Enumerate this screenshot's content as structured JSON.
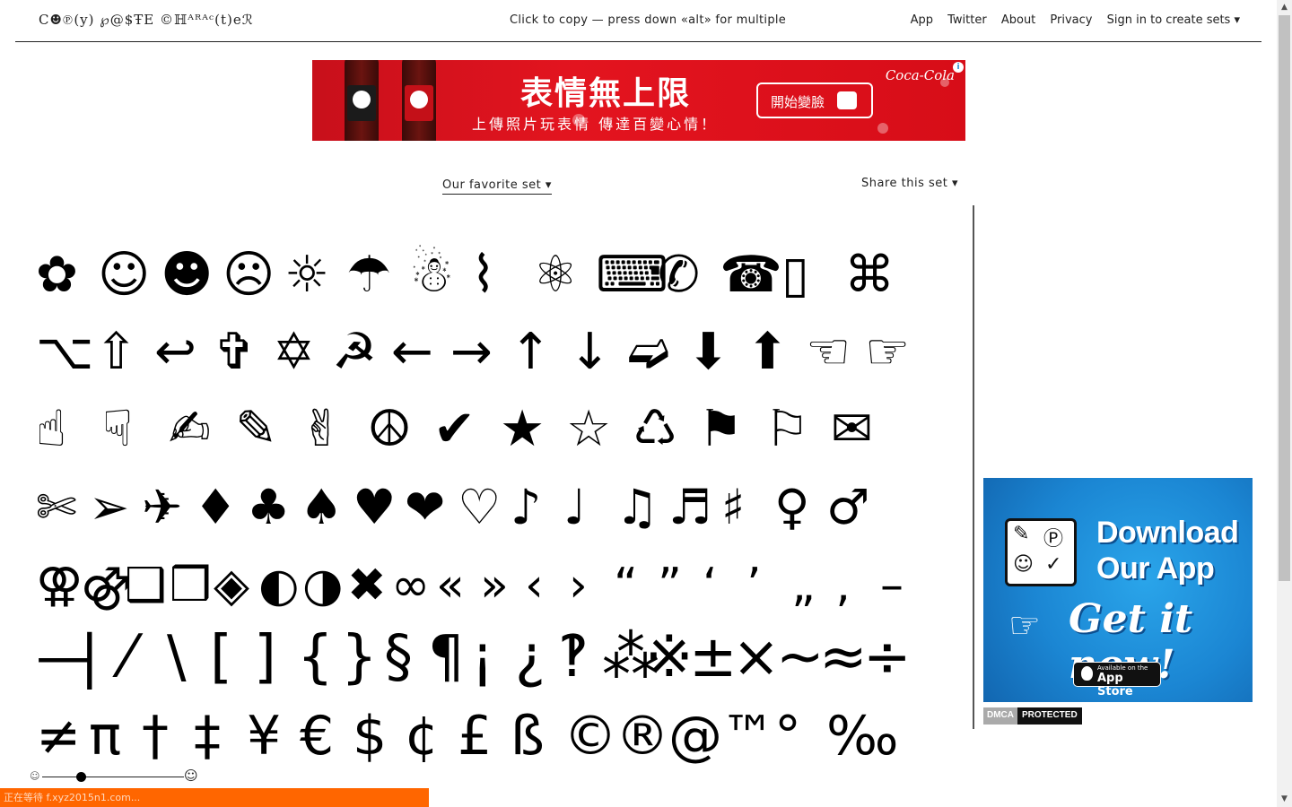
{
  "header": {
    "logo": "C☻℗(y) ℘@$ŦE ©ℍᴬᴿᴬᶜ(t)eℛ",
    "tagline": "Click to copy — press down «alt» for multiple",
    "nav": [
      "App",
      "Twitter",
      "About",
      "Privacy",
      "Sign in to create sets ▾"
    ]
  },
  "ad_banner": {
    "title": "表情無上限",
    "subtitle": "上傳照片玩表情 傳達百變心情！",
    "button": "開始變臉",
    "brand": "Coca-Cola",
    "info": "i"
  },
  "set": {
    "selected": "Our favorite set ▾",
    "share": "Share this set ▾"
  },
  "glyph_rows": [
    [
      "✿",
      "☺",
      "☻",
      "☹",
      "☼",
      "☂",
      "☃",
      "⌇",
      "⚛",
      "⌨",
      "✆",
      "☎",
      "▯",
      "⌘"
    ],
    [
      "⌥",
      "⇧",
      "↩",
      "✞",
      "✡",
      "☭",
      "←",
      "→",
      "↑",
      "↓",
      "➫",
      "⬇",
      "⬆",
      "☜",
      "☞"
    ],
    [
      "☝",
      "☟",
      "✍",
      "✎",
      "✌",
      "☮",
      "✔",
      "★",
      "☆",
      "♺",
      "⚑",
      "⚐",
      "✉"
    ],
    [
      "✄",
      "➢",
      "✈",
      "♦",
      "♣",
      "♠",
      "♥",
      "❤",
      "♡",
      "♪",
      "♩",
      "♫",
      "♬",
      "♯",
      "♀",
      "♂"
    ],
    [
      "⚢",
      "⚣",
      "❑",
      "❒",
      "◈",
      "◐",
      "◑",
      "✖",
      "∞",
      "«",
      "»",
      "‹",
      "›",
      "“",
      "”",
      "‘",
      "’",
      "„",
      "‚",
      "–"
    ],
    [
      "—",
      "|",
      "⁄",
      "\\",
      "[",
      "]",
      "{",
      "}",
      "§",
      "¶",
      "¡",
      "¿",
      "‽",
      "⁂",
      "※",
      "±",
      "×",
      "~",
      "≈",
      "÷"
    ],
    [
      "≠",
      "π",
      "†",
      "‡",
      "¥",
      "€",
      "$",
      "¢",
      "£",
      "ß",
      "©",
      "®",
      "@",
      "™",
      "°",
      "‰"
    ]
  ],
  "slider": {
    "small_icon": "☺",
    "large_icon": "☺",
    "level": 0.27
  },
  "app_ad": {
    "line1": "Download",
    "line2": "Our App",
    "cta": "Get it now!",
    "store_small": "Available on the",
    "store_big": "App Store",
    "card_symbols": [
      "✎",
      "Ⓟ",
      "☺",
      "✓"
    ],
    "hand": "☞"
  },
  "dmca": {
    "left": "DMCA",
    "right": "PROTECTED"
  },
  "status_bar": "正在等待 f.xyz2015n1.com..."
}
